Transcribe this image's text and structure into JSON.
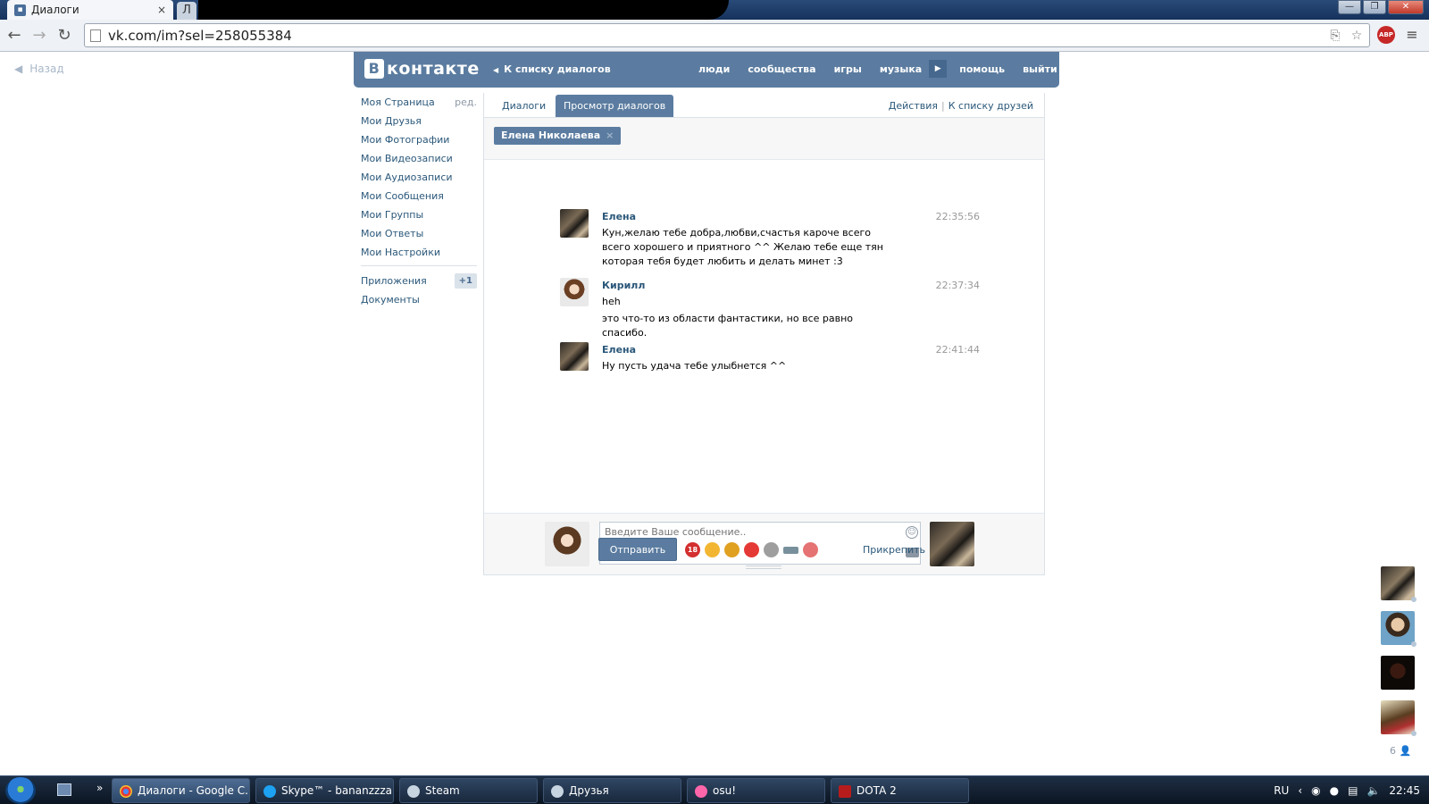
{
  "browser": {
    "tab_title": "Диалоги",
    "tab_close": "×",
    "next_tab_glyph": "Л",
    "url": "vk.com/im?sel=258055384",
    "window_buttons": [
      "—",
      "❐",
      "✕"
    ]
  },
  "vk": {
    "back_label": "Назад",
    "logo_text": "контакте",
    "logo_letter": "В",
    "to_dialogs": "К списку диалогов",
    "topnav": [
      "люди",
      "сообщества",
      "игры",
      "музыка",
      "помощь",
      "выйти"
    ],
    "sidebar": {
      "items": [
        "Моя Страница",
        "Мои Друзья",
        "Мои Фотографии",
        "Мои Видеозаписи",
        "Мои Аудиозаписи",
        "Мои Сообщения",
        "Мои Группы",
        "Мои Ответы",
        "Мои Настройки"
      ],
      "edit": "ред.",
      "apps": "Приложения",
      "apps_badge": "+1",
      "docs": "Документы"
    },
    "tabs": {
      "dialogs": "Диалоги",
      "view": "Просмотр диалогов",
      "actions": "Действия",
      "friends_list": "К списку друзей"
    },
    "chip": {
      "name": "Елена Николаева",
      "remove": "×"
    },
    "messages": [
      {
        "author": "Елена",
        "time": "22:35:56",
        "text": "Кун,желаю тебе добра,любви,счастья кароче всего всего хорошего и приятного ^^ Желаю тебе еще тян которая тебя будет любить и делать минет :3"
      },
      {
        "author": "Кирилл",
        "time": "22:37:34",
        "text": "heh"
      },
      {
        "author": "",
        "time": "",
        "text": "это что-то из области фантастики, но все равно спасибо."
      },
      {
        "author": "Елена",
        "time": "22:41:44",
        "text": "Ну пусть удача тебе улыбнется ^^"
      }
    ],
    "compose": {
      "placeholder": "Введите Ваше сообщение..",
      "send": "Отправить",
      "attach": "Прикрепить"
    },
    "emoji_badge": "18",
    "friends_count": "6"
  },
  "taskbar": {
    "items": [
      "Диалоги - Google C...",
      "Skype™ - bananzzza...",
      "Steam",
      "Друзья",
      "osu!",
      "DOTA 2"
    ],
    "more": "»",
    "lang": "RU",
    "clock": "22:45"
  },
  "colors": {
    "vk_blue": "#5b7ca0",
    "link": "#2b587a"
  }
}
